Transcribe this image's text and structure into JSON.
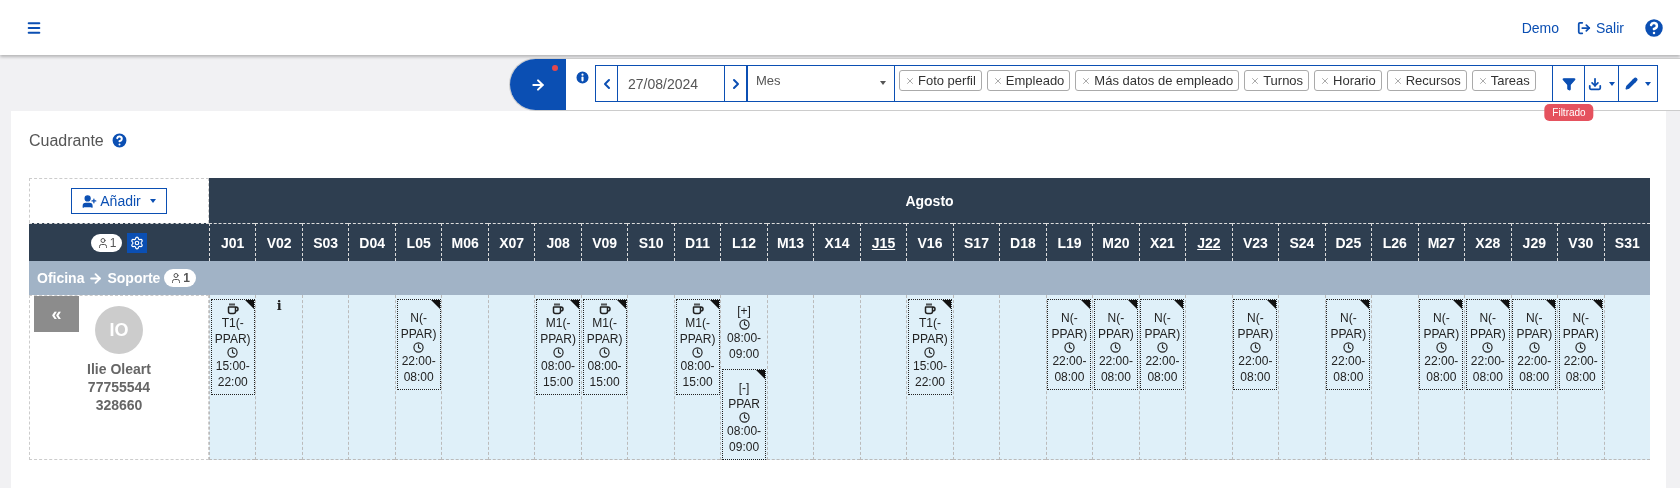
{
  "topbar": {
    "user": "Demo",
    "logout": "Salir"
  },
  "toolbar": {
    "date": "27/08/2024",
    "period": "Mes",
    "tags": [
      "Foto perfil",
      "Empleado",
      "Más datos de empleado",
      "Turnos",
      "Horario",
      "Recursos",
      "Tareas"
    ],
    "filter_badge": "Filtrado",
    "notification": true
  },
  "panel": {
    "title": "Cuadrante"
  },
  "table": {
    "add_button": "Añadir",
    "month": "Agosto",
    "employee_count": "1",
    "days": [
      {
        "label": "J01",
        "underlined": false,
        "shifts": [
          {
            "kind": "card",
            "cup": true,
            "code": "T1(-PPAR)",
            "time": "15:00-22:00"
          }
        ]
      },
      {
        "label": "V02",
        "underlined": false,
        "info": "i"
      },
      {
        "label": "S03",
        "underlined": false
      },
      {
        "label": "D04",
        "underlined": false
      },
      {
        "label": "L05",
        "underlined": false,
        "shifts": [
          {
            "kind": "card",
            "cup": false,
            "code": "N(-PPAR)",
            "time": "22:00-08:00"
          }
        ]
      },
      {
        "label": "M06",
        "underlined": false
      },
      {
        "label": "X07",
        "underlined": false
      },
      {
        "label": "J08",
        "underlined": false,
        "shifts": [
          {
            "kind": "card",
            "cup": true,
            "code": "M1(-PPAR)",
            "time": "08:00-15:00"
          }
        ]
      },
      {
        "label": "V09",
        "underlined": false,
        "shifts": [
          {
            "kind": "card",
            "cup": true,
            "code": "M1(-PPAR)",
            "time": "08:00-15:00"
          }
        ]
      },
      {
        "label": "S10",
        "underlined": false
      },
      {
        "label": "D11",
        "underlined": false,
        "shifts": [
          {
            "kind": "card",
            "cup": true,
            "code": "M1(-PPAR)",
            "time": "08:00-15:00"
          }
        ]
      },
      {
        "label": "L12",
        "underlined": false,
        "shifts": [
          {
            "kind": "plain",
            "cup": false,
            "code": "[+]",
            "time": "08:00-09:00"
          },
          {
            "kind": "card",
            "cup": false,
            "code": "[-] PPAR",
            "time": "08:00-09:00"
          }
        ]
      },
      {
        "label": "M13",
        "underlined": false
      },
      {
        "label": "X14",
        "underlined": false
      },
      {
        "label": "J15",
        "underlined": true
      },
      {
        "label": "V16",
        "underlined": false,
        "shifts": [
          {
            "kind": "card",
            "cup": true,
            "code": "T1(-PPAR)",
            "time": "15:00-22:00"
          }
        ]
      },
      {
        "label": "S17",
        "underlined": false
      },
      {
        "label": "D18",
        "underlined": false
      },
      {
        "label": "L19",
        "underlined": false,
        "shifts": [
          {
            "kind": "card",
            "cup": false,
            "code": "N(-PPAR)",
            "time": "22:00-08:00"
          }
        ]
      },
      {
        "label": "M20",
        "underlined": false,
        "shifts": [
          {
            "kind": "card",
            "cup": false,
            "code": "N(-PPAR)",
            "time": "22:00-08:00"
          }
        ]
      },
      {
        "label": "X21",
        "underlined": false,
        "shifts": [
          {
            "kind": "card",
            "cup": false,
            "code": "N(-PPAR)",
            "time": "22:00-08:00"
          }
        ]
      },
      {
        "label": "J22",
        "underlined": true
      },
      {
        "label": "V23",
        "underlined": false,
        "shifts": [
          {
            "kind": "card",
            "cup": false,
            "code": "N(-PPAR)",
            "time": "22:00-08:00"
          }
        ]
      },
      {
        "label": "S24",
        "underlined": false
      },
      {
        "label": "D25",
        "underlined": false,
        "shifts": [
          {
            "kind": "card",
            "cup": false,
            "code": "N(-PPAR)",
            "time": "22:00-08:00"
          }
        ]
      },
      {
        "label": "L26",
        "underlined": false
      },
      {
        "label": "M27",
        "underlined": false,
        "shifts": [
          {
            "kind": "card",
            "cup": false,
            "code": "N(-PPAR)",
            "time": "22:00-08:00"
          }
        ]
      },
      {
        "label": "X28",
        "underlined": false,
        "shifts": [
          {
            "kind": "card",
            "cup": false,
            "code": "N(-PPAR)",
            "time": "22:00-08:00"
          }
        ]
      },
      {
        "label": "J29",
        "underlined": false,
        "shifts": [
          {
            "kind": "card",
            "cup": false,
            "code": "N(-PPAR)",
            "time": "22:00-08:00"
          }
        ]
      },
      {
        "label": "V30",
        "underlined": false,
        "shifts": [
          {
            "kind": "card",
            "cup": false,
            "code": "N(-PPAR)",
            "time": "22:00-08:00"
          }
        ]
      },
      {
        "label": "S31",
        "underlined": false
      }
    ],
    "group": {
      "from": "Oficina",
      "to": "Soporte",
      "count": "1"
    },
    "employee": {
      "collapse": "«",
      "initials": "IO",
      "name": "Ilie Oleart",
      "id": "77755544",
      "code": "328660"
    }
  }
}
